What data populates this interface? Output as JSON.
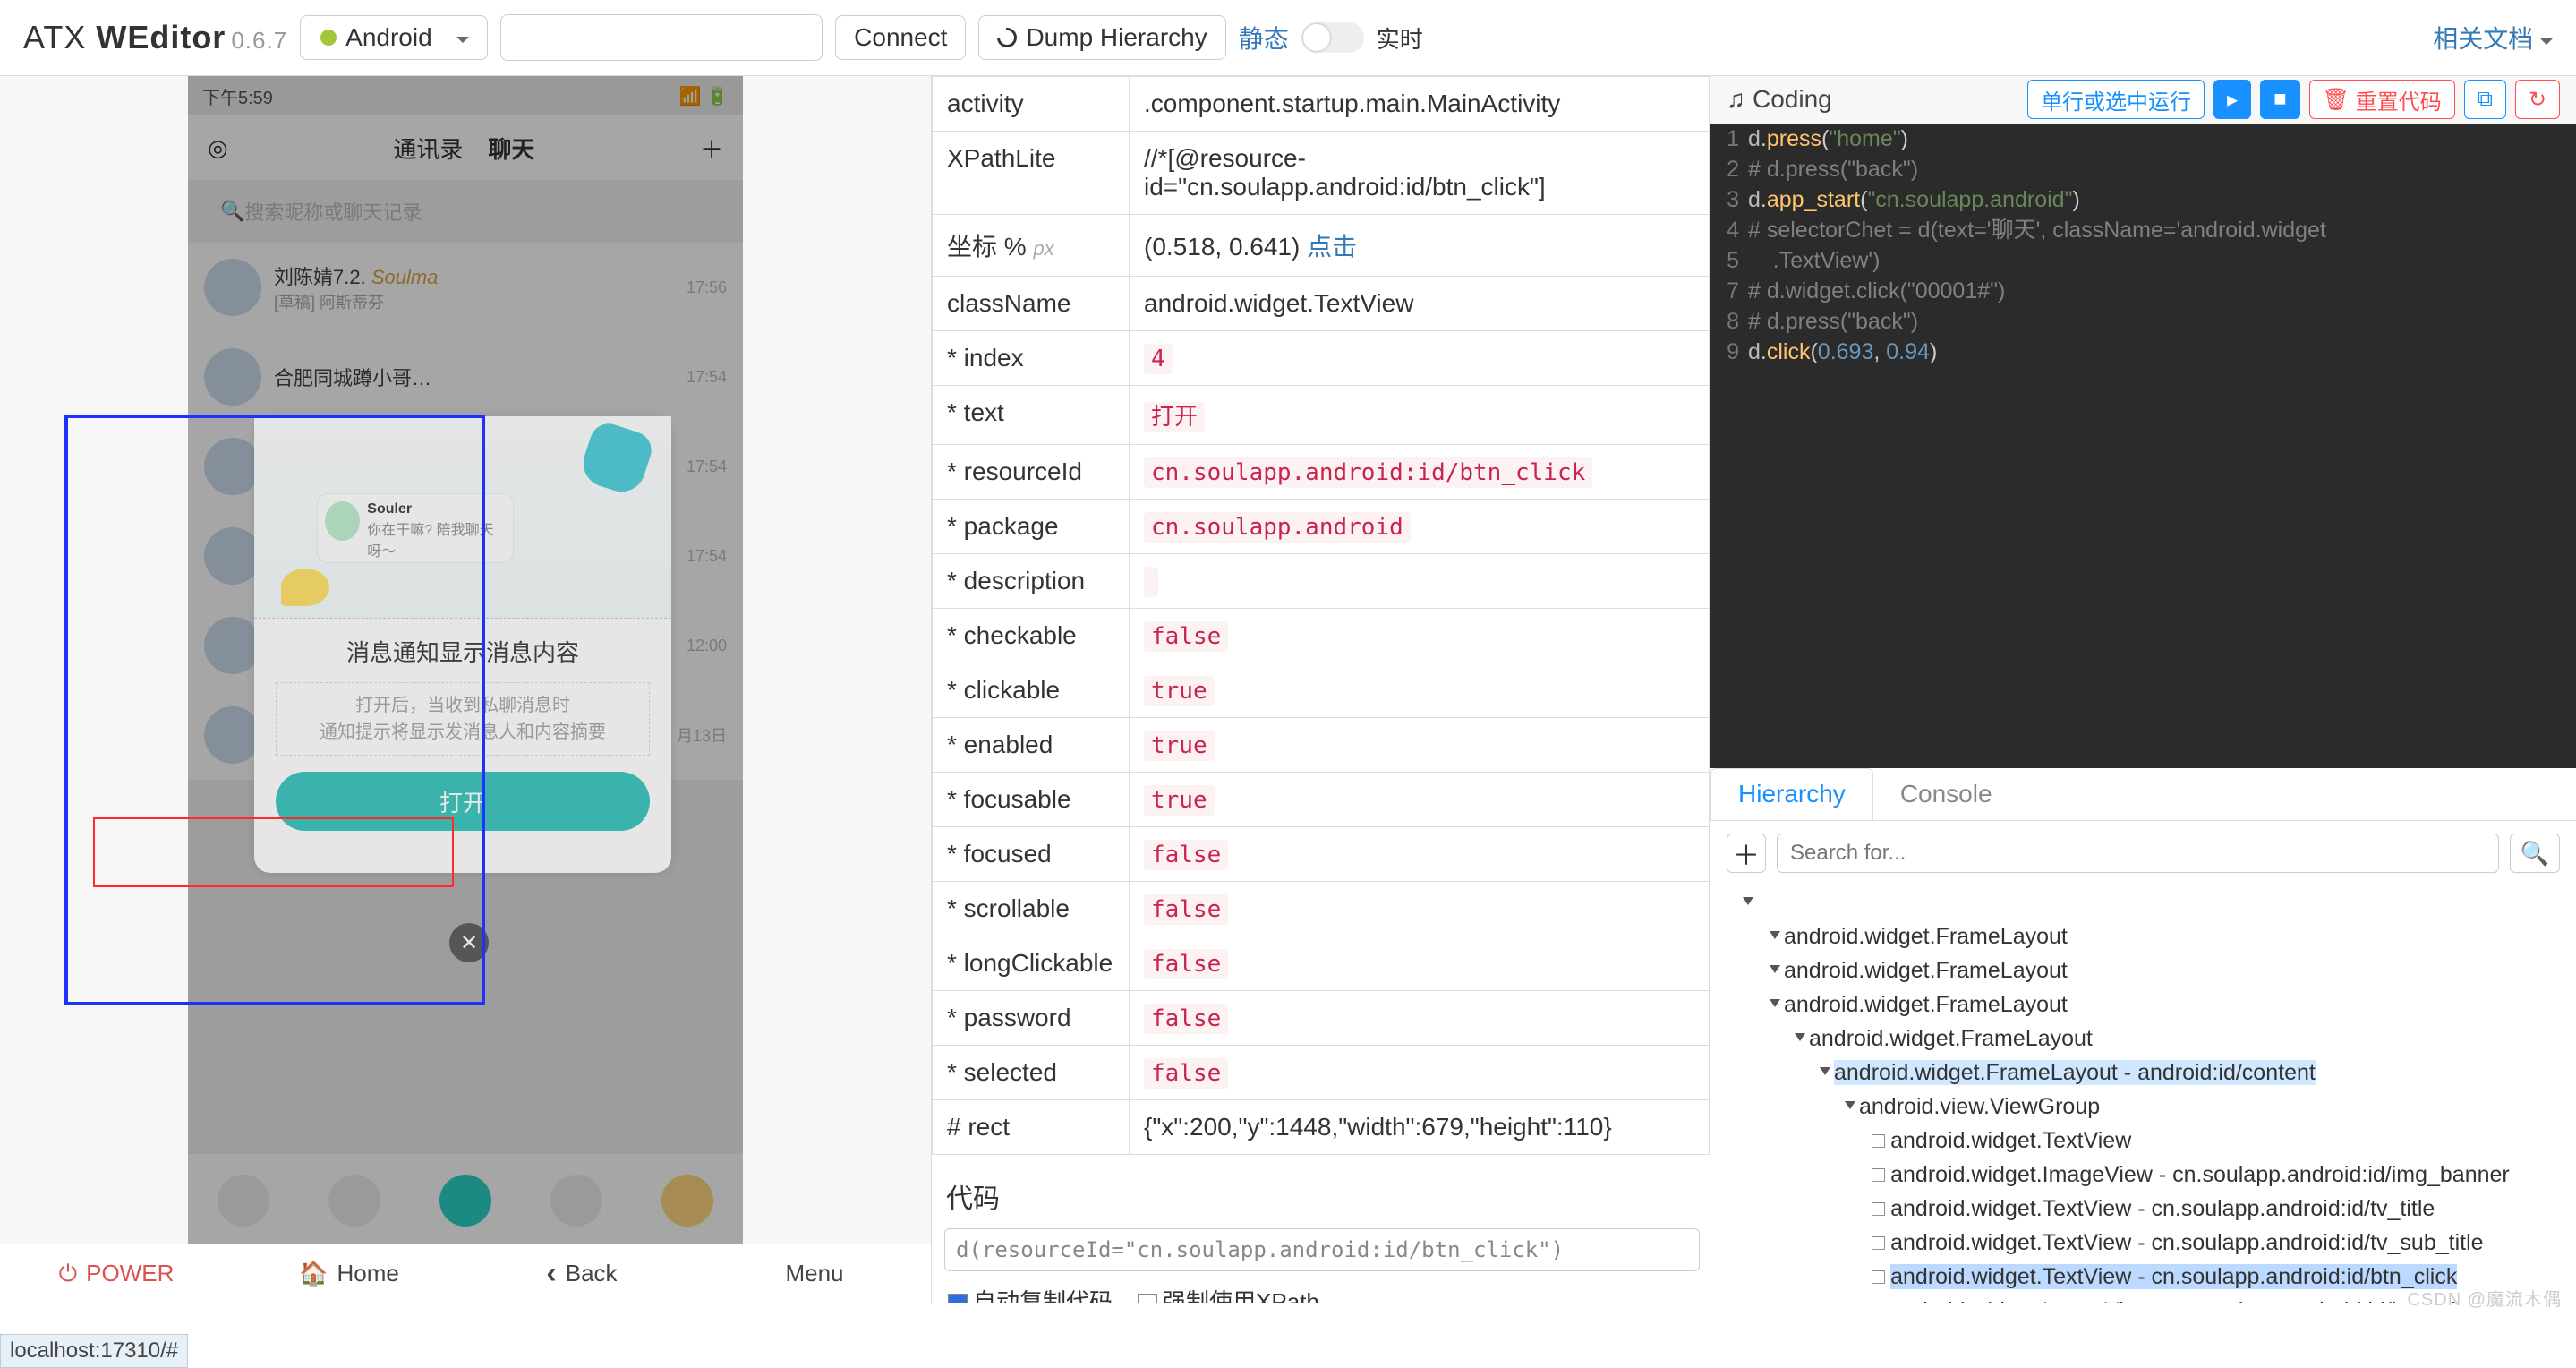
{
  "brand": {
    "name_a": "ATX ",
    "name_b": "WEditor",
    "version": "0.6.7"
  },
  "topbar": {
    "platform": "Android",
    "connect": "Connect",
    "dump": "Dump Hierarchy",
    "mode_static": "静态",
    "mode_live": "实时",
    "docs": "相关文档"
  },
  "phone": {
    "clock": "下午5:59",
    "tabs": {
      "contacts": "通讯录",
      "chat": "聊天"
    },
    "search_placeholder": "搜索昵称或聊天记录",
    "items": [
      {
        "name": "刘陈婧7.2.",
        "tag": "Soulma",
        "sub": "[草稿] 阿斯蒂芬",
        "time": "17:56"
      },
      {
        "name": "合肥同城蹲小哥…",
        "time": "17:54"
      },
      {
        "name": " ",
        "time": "17:54"
      },
      {
        "name": " ",
        "time": "17:54"
      },
      {
        "name": " ",
        "time": "12:00"
      },
      {
        "name": " ",
        "time": "月13日"
      }
    ],
    "modal": {
      "souler": "Souler",
      "souler_sub": "你在干嘛? 陪我聊天呀～",
      "title": "消息通知显示消息内容",
      "desc1": "打开后，当收到私聊消息时",
      "desc2": "通知提示将显示发消息人和内容摘要",
      "btn": "打开"
    }
  },
  "left_footer": {
    "power": "POWER",
    "home": "Home",
    "back": "Back",
    "menu": "Menu"
  },
  "props": [
    {
      "k": "activity",
      "v": ".component.startup.main.MainActivity"
    },
    {
      "k": "XPathLite",
      "v": "//*[@resource-id=\"cn.soulapp.android:id/btn_click\"]"
    },
    {
      "k": "坐标 %",
      "px": "px",
      "v": "(0.518, 0.641) ",
      "link": "点击"
    },
    {
      "k": "className",
      "v": "android.widget.TextView"
    },
    {
      "k": "* index",
      "code": "4"
    },
    {
      "k": "* text",
      "code": "打开"
    },
    {
      "k": "* resourceId",
      "code": "cn.soulapp.android:id/btn_click"
    },
    {
      "k": "* package",
      "code": "cn.soulapp.android"
    },
    {
      "k": "* description",
      "code": ""
    },
    {
      "k": "* checkable",
      "code": "false"
    },
    {
      "k": "* clickable",
      "code": "true"
    },
    {
      "k": "* enabled",
      "code": "true"
    },
    {
      "k": "* focusable",
      "code": "true"
    },
    {
      "k": "* focused",
      "code": "false"
    },
    {
      "k": "* scrollable",
      "code": "false"
    },
    {
      "k": "* longClickable",
      "code": "false"
    },
    {
      "k": "* password",
      "code": "false"
    },
    {
      "k": "* selected",
      "code": "false"
    },
    {
      "k": "# rect",
      "v": "{\"x\":200,\"y\":1448,\"width\":679,\"height\":110}"
    }
  ],
  "mid": {
    "code_heading": "代码",
    "code_value": "d(resourceId=\"cn.soulapp.android:id/btn_click\")",
    "chk1": "自动复制代码",
    "chk2": "强制使用XPath"
  },
  "coding": {
    "title": "Coding",
    "run": "单行或选中运行",
    "reset": "重置代码",
    "lines": [
      [
        [
          "id",
          "d"
        ],
        [
          "punc",
          "."
        ],
        [
          "fn",
          "press"
        ],
        [
          "punc",
          "("
        ],
        [
          "str",
          "\"home\""
        ],
        [
          "punc",
          ")"
        ]
      ],
      [
        [
          "cm",
          "# d.press(\"back\")"
        ]
      ],
      [
        [
          "id",
          "d"
        ],
        [
          "punc",
          "."
        ],
        [
          "fn",
          "app_start"
        ],
        [
          "punc",
          "("
        ],
        [
          "str",
          "\"cn.soulapp.android\""
        ],
        [
          "punc",
          ")"
        ]
      ],
      [
        [
          "cm",
          "# selectorChet = d(text='聊天', className='android.widget"
        ]
      ],
      [
        [
          "cm",
          "    .TextView')"
        ]
      ],
      [
        [
          "",
          ""
        ]
      ],
      [
        [
          "cm",
          "# d.widget.click(\"00001#\")"
        ]
      ],
      [
        [
          "cm",
          "# d.press(\"back\")"
        ]
      ],
      [
        [
          "id",
          "d"
        ],
        [
          "punc",
          "."
        ],
        [
          "fn",
          "click"
        ],
        [
          "punc",
          "("
        ],
        [
          "num",
          "0.693"
        ],
        [
          "punc",
          ", "
        ],
        [
          "num",
          "0.94"
        ],
        [
          "punc",
          ")"
        ]
      ]
    ]
  },
  "tabs": {
    "hierarchy": "Hierarchy",
    "console": "Console"
  },
  "hs_placeholder": "Search for...",
  "tree": [
    {
      "pad": 1,
      "tog": true,
      "txt": ""
    },
    {
      "pad": 2,
      "tog": true,
      "txt": "android.widget.FrameLayout"
    },
    {
      "pad": 2,
      "tog": true,
      "txt": "android.widget.FrameLayout"
    },
    {
      "pad": 2,
      "tog": true,
      "txt": "android.widget.FrameLayout"
    },
    {
      "pad": 3,
      "tog": true,
      "txt": "android.widget.FrameLayout"
    },
    {
      "pad": 4,
      "tog": true,
      "txt": "android.widget.FrameLayout - android:id/content",
      "hl": true
    },
    {
      "pad": 5,
      "tog": true,
      "txt": "android.view.ViewGroup"
    },
    {
      "pad": 6,
      "leaf": true,
      "txt": "android.widget.TextView"
    },
    {
      "pad": 6,
      "leaf": true,
      "txt": "android.widget.ImageView - cn.soulapp.android:id/img_banner"
    },
    {
      "pad": 6,
      "leaf": true,
      "txt": "android.widget.TextView - cn.soulapp.android:id/tv_title"
    },
    {
      "pad": 6,
      "leaf": true,
      "txt": "android.widget.TextView - cn.soulapp.android:id/tv_sub_title"
    },
    {
      "pad": 6,
      "leaf": true,
      "txt": "android.widget.TextView - cn.soulapp.android:id/btn_click",
      "sel": true
    },
    {
      "pad": 6,
      "leaf": true,
      "txt": "android.widget.ImageView - cn.soulapp.android:id/img_close"
    }
  ],
  "url": "localhost:17310/#",
  "watermark": "CSDN @魔流木偶"
}
